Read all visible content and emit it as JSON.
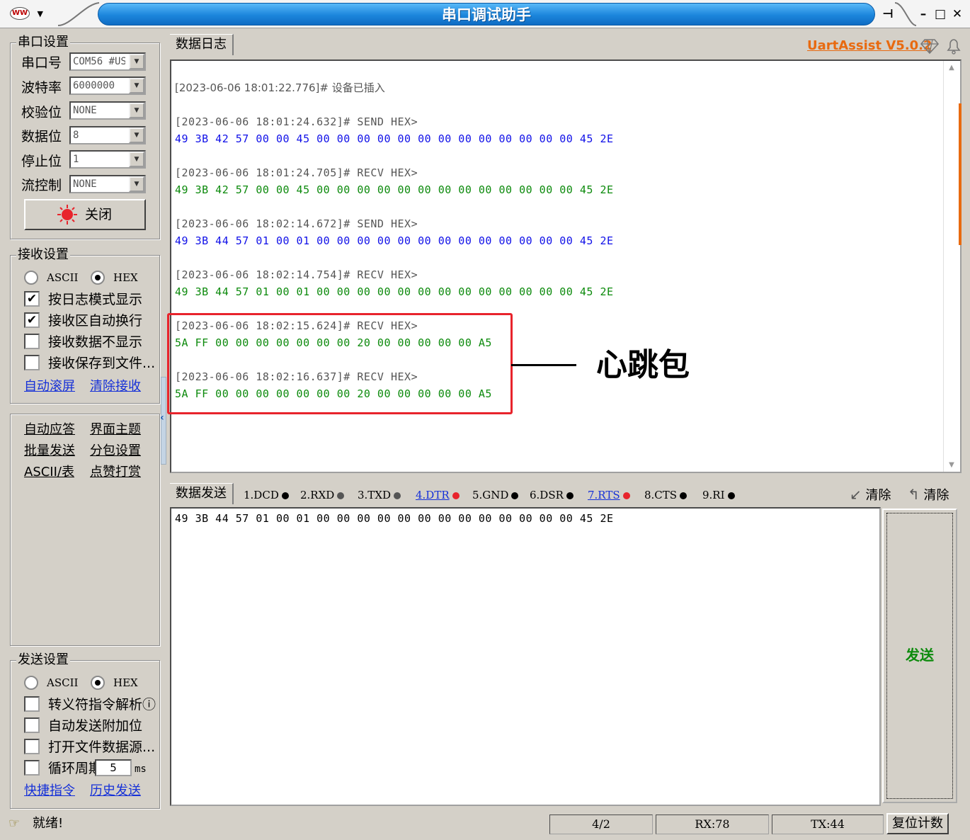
{
  "window": {
    "title": "串口调试助手",
    "controls": [
      "minimize-icon",
      "maximize-icon",
      "close-icon"
    ],
    "pin_icon": "pin-icon"
  },
  "serial_settings": {
    "title": "串口设置",
    "fields": [
      {
        "label": "串口号",
        "value": "COM56 #US"
      },
      {
        "label": "波特率",
        "value": "6000000"
      },
      {
        "label": "校验位",
        "value": "NONE"
      },
      {
        "label": "数据位",
        "value": "8"
      },
      {
        "label": "停止位",
        "value": "1"
      },
      {
        "label": "流控制",
        "value": "NONE"
      }
    ],
    "toggle_button": "关闭",
    "toggle_state_color": "#e8242c"
  },
  "receive_settings": {
    "title": "接收设置",
    "mode_ascii": "ASCII",
    "mode_hex": "HEX",
    "selected_mode": "HEX",
    "options": [
      {
        "label": "按日志模式显示",
        "checked": "✔"
      },
      {
        "label": "接收区自动换行",
        "checked": "✔"
      },
      {
        "label": "接收数据不显示",
        "checked": ""
      },
      {
        "label": "接收保存到文件...",
        "checked": ""
      }
    ],
    "links": [
      "自动滚屏",
      "清除接收"
    ]
  },
  "tools": {
    "links": [
      "自动应答",
      "界面主题",
      "批量发送",
      "分包设置",
      "ASCII/表",
      "点赞打赏"
    ]
  },
  "send_settings": {
    "title": "发送设置",
    "mode_ascii": "ASCII",
    "mode_hex": "HEX",
    "selected_mode": "HEX",
    "options": [
      {
        "label": "转义符指令解析ⓘ",
        "checked": ""
      },
      {
        "label": "自动发送附加位",
        "checked": ""
      },
      {
        "label": "打开文件数据源...",
        "checked": ""
      },
      {
        "label": "循环周期",
        "checked": ""
      }
    ],
    "cycle_value": "5",
    "cycle_unit": "ms",
    "links": [
      "快捷指令",
      "历史发送"
    ]
  },
  "log": {
    "tab": "数据日志",
    "brand": "UartAssist V5.0.2",
    "brand_color": "#e86a10",
    "entries": [
      {
        "head": "[2023-06-06 18:01:22.776]# 设备已插入",
        "data": "",
        "kind": "event"
      },
      {
        "head": "[2023-06-06 18:01:24.632]# SEND HEX>",
        "data": "49 3B 42 57 00 00 45 00 00 00 00 00 00 00 00 00 00 00 00 00 45 2E",
        "kind": "send"
      },
      {
        "head": "[2023-06-06 18:01:24.705]# RECV HEX>",
        "data": "49 3B 42 57 00 00 45 00 00 00 00 00 00 00 00 00 00 00 00 00 45 2E",
        "kind": "recv"
      },
      {
        "head": "[2023-06-06 18:02:14.672]# SEND HEX>",
        "data": "49 3B 44 57 01 00 01 00 00 00 00 00 00 00 00 00 00 00 00 00 45 2E",
        "kind": "send"
      },
      {
        "head": "[2023-06-06 18:02:14.754]# RECV HEX>",
        "data": "49 3B 44 57 01 00 01 00 00 00 00 00 00 00 00 00 00 00 00 00 45 2E",
        "kind": "recv"
      },
      {
        "head": "[2023-06-06 18:02:15.624]# RECV HEX>",
        "data": "5A FF 00 00 00 00 00 00 00 20 00 00 00 00 00 A5",
        "kind": "recv"
      },
      {
        "head": "[2023-06-06 18:02:16.637]# RECV HEX>",
        "data": "5A FF 00 00 00 00 00 00 00 20 00 00 00 00 00 A5",
        "kind": "recv"
      }
    ],
    "annotation": "心跳包"
  },
  "send": {
    "tab": "数据发送",
    "signals": [
      {
        "label": "1.DCD",
        "color": "#000000",
        "link": false
      },
      {
        "label": "2.RXD",
        "color": "#444444",
        "link": false
      },
      {
        "label": "3.TXD",
        "color": "#444444",
        "link": false
      },
      {
        "label": "4.DTR",
        "color": "#e8242c",
        "link": true
      },
      {
        "label": "5.GND",
        "color": "#000000",
        "link": false
      },
      {
        "label": "6.DSR",
        "color": "#000000",
        "link": false
      },
      {
        "label": "7.RTS",
        "color": "#e8242c",
        "link": true
      },
      {
        "label": "8.CTS",
        "color": "#000000",
        "link": false
      },
      {
        "label": "9.RI",
        "color": "#000000",
        "link": false
      }
    ],
    "clear_label_1": "清除",
    "clear_label_2": "清除",
    "input_value": "49 3B 44 57 01 00 01 00 00 00 00 00 00 00 00 00 00 00 00 00 45 2E",
    "send_button": "发送"
  },
  "status": {
    "ready": "就绪!",
    "page": "4/2",
    "rx": "RX:78",
    "tx": "TX:44",
    "reset_button": "复位计数"
  }
}
